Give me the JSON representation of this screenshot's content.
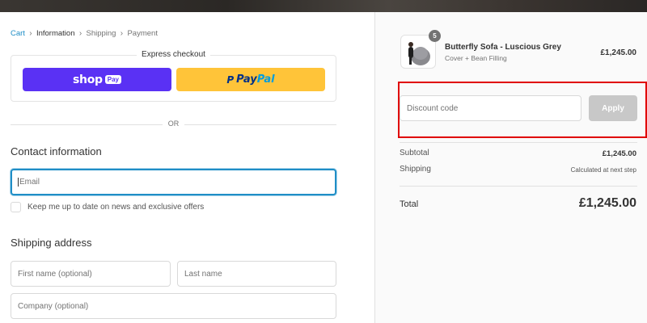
{
  "breadcrumb": {
    "cart": "Cart",
    "information": "Information",
    "shipping": "Shipping",
    "payment": "Payment"
  },
  "express": {
    "title": "Express checkout",
    "shop_word": "shop",
    "shop_pay": "Pay",
    "paypal_pay": "Pay",
    "paypal_pal": "Pal",
    "paypal_icon": "P"
  },
  "divider": {
    "or": "OR"
  },
  "contact": {
    "title": "Contact information",
    "email_placeholder": "Email",
    "newsletter_label": "Keep me up to date on news and exclusive offers"
  },
  "shipping_address": {
    "title": "Shipping address",
    "first_name_placeholder": "First name (optional)",
    "last_name_placeholder": "Last name",
    "company_placeholder": "Company (optional)"
  },
  "order": {
    "product_name": "Butterfly Sofa - Luscious Grey",
    "variant": "Cover + Bean Filling",
    "price": "£1,245.00",
    "quantity_badge": "5"
  },
  "discount": {
    "placeholder": "Discount code",
    "apply_label": "Apply"
  },
  "summary": {
    "subtotal_label": "Subtotal",
    "subtotal_value": "£1,245.00",
    "shipping_label": "Shipping",
    "shipping_value": "Calculated at next step",
    "total_label": "Total",
    "total_value": "£1,245.00"
  },
  "colors": {
    "accent_link": "#1f8ec6",
    "shop_pay": "#5a31f4",
    "paypal": "#ffc439",
    "highlight_box": "#e00000"
  }
}
